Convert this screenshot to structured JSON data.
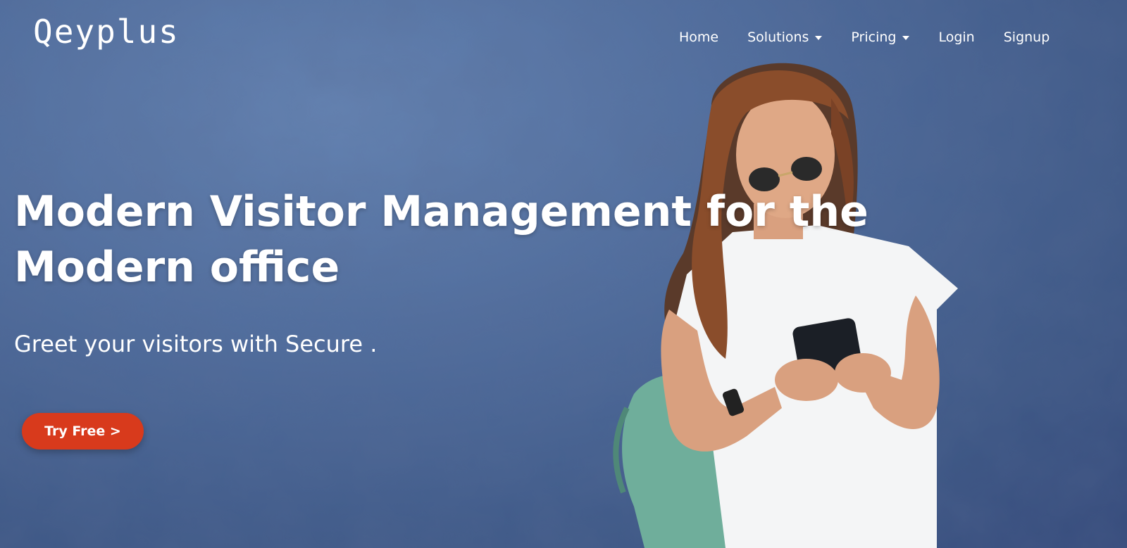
{
  "brand": {
    "logo_text": "Qeyplus"
  },
  "nav": {
    "items": [
      {
        "label": "Home",
        "dropdown": false
      },
      {
        "label": "Solutions",
        "dropdown": true
      },
      {
        "label": "Pricing",
        "dropdown": true
      },
      {
        "label": "Login",
        "dropdown": false
      },
      {
        "label": "Signup",
        "dropdown": false
      }
    ]
  },
  "hero": {
    "headline": "Modern Visitor Management for the Modern office",
    "subheadline": "Greet your visitors with Secure .",
    "cta_label": "Try Free >",
    "image_subject": "woman-using-phone-photo"
  },
  "colors": {
    "background": "#4f6c9c",
    "cta": "#d83a1c",
    "text": "#ffffff"
  }
}
